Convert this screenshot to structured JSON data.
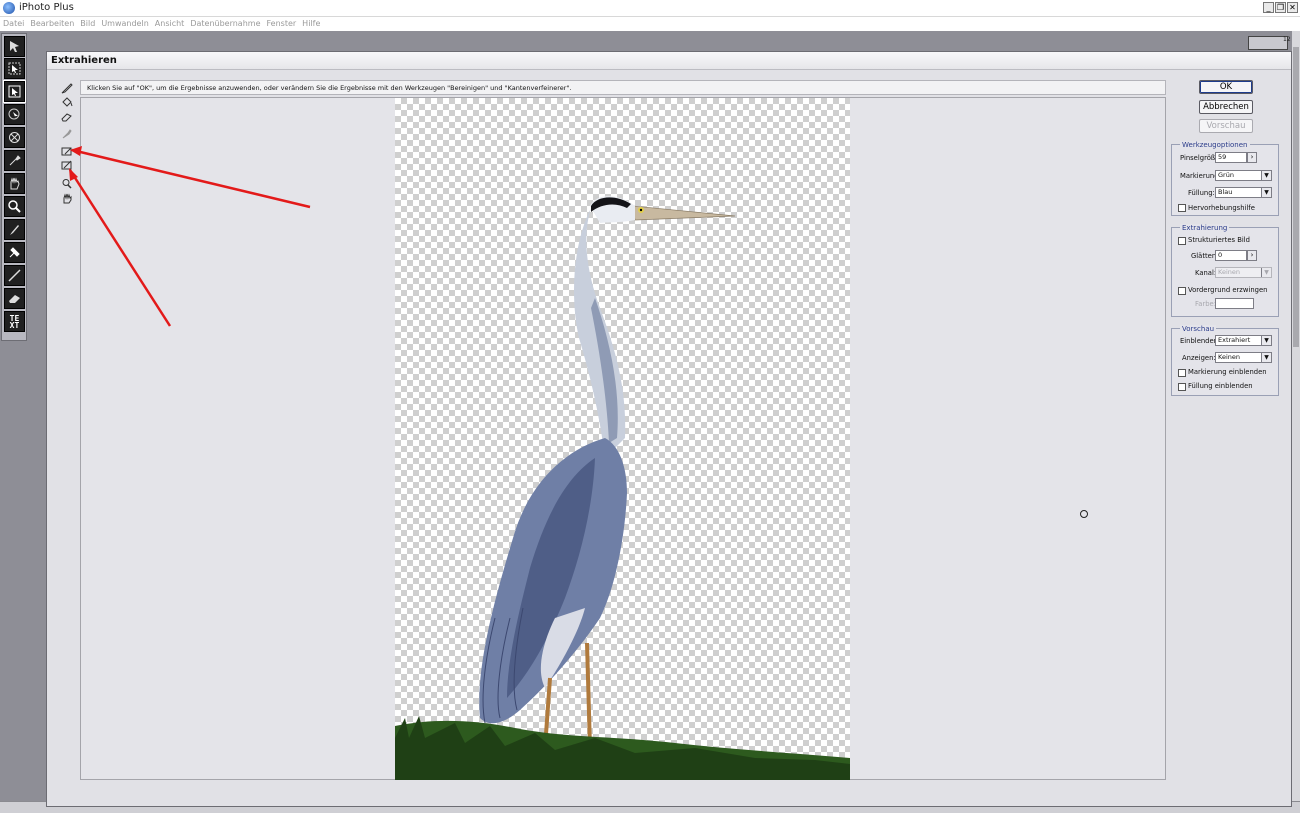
{
  "app": {
    "title": "iPhoto Plus"
  },
  "menu": [
    "Datei",
    "Bearbeiten",
    "Bild",
    "Umwandeln",
    "Ansicht",
    "Datenübernahme",
    "Fenster",
    "Hilfe"
  ],
  "ruler": {
    "number": "12"
  },
  "dialog": {
    "title": "Extrahieren",
    "hint": "Klicken Sie auf \"OK\", um die Ergebnisse anzuwenden, oder verändern Sie die Ergebnisse mit den Werkzeugen \"Bereinigen\" und \"Kantenverfeinerer\".",
    "buttons": {
      "ok": "OK",
      "cancel": "Abbrechen",
      "preview": "Vorschau"
    },
    "tool_options": {
      "legend": "Werkzeugoptionen",
      "brush_size_label": "Pinselgröße:",
      "brush_size_value": "59",
      "marking_label": "Markierung:",
      "marking_value": "Grün",
      "fill_label": "Füllung:",
      "fill_value": "Blau",
      "highlight_help": "Hervorhebungshilfe"
    },
    "extraction": {
      "legend": "Extrahierung",
      "textured_image": "Strukturiertes Bild",
      "smooth_label": "Glätten:",
      "smooth_value": "0",
      "channel_label": "Kanal:",
      "channel_value": "Keinen",
      "force_foreground": "Vordergrund erzwingen",
      "color_label": "Farbe:"
    },
    "preview": {
      "legend": "Vorschau",
      "show_label": "Einblenden:",
      "show_value": "Extrahiert",
      "display_label": "Anzeigen:",
      "display_value": "Keinen",
      "show_marking": "Markierung einblenden",
      "show_fill": "Füllung einblenden"
    }
  },
  "colors": {
    "arrow": "#e31a1a",
    "accent": "#2b3c8a",
    "grass": "#2d5a1e",
    "heron": "#6f7fa6"
  }
}
